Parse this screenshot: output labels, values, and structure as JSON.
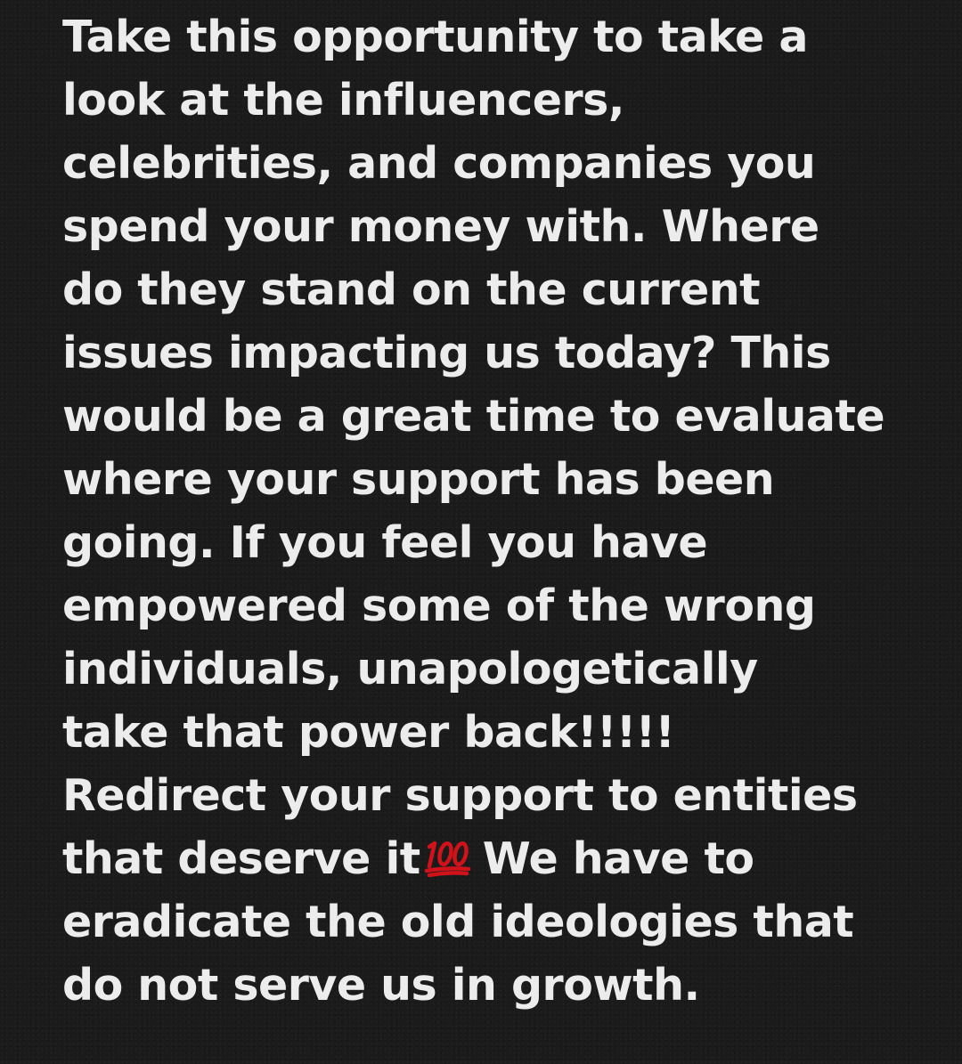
{
  "post": {
    "lines": [
      "Take this opportunity to take a",
      "look at the influencers,",
      "celebrities, and companies you",
      "spend your money with. Where",
      "do they stand on the current",
      "issues impacting us today? This",
      "would be a great time to evaluate",
      "where your support has been",
      "going. If you feel you have",
      "empowered some of the wrong",
      "individuals,  unapologetically",
      "take that power back!!!!!",
      "Redirect your support to entities",
      "that deserve it",
      "eradicate the old ideologies that",
      "do not serve us in growth."
    ],
    "line14_after_emoji": "We have to",
    "emoji": {
      "name": "hundred-points-icon",
      "color": "#d0121b"
    }
  }
}
